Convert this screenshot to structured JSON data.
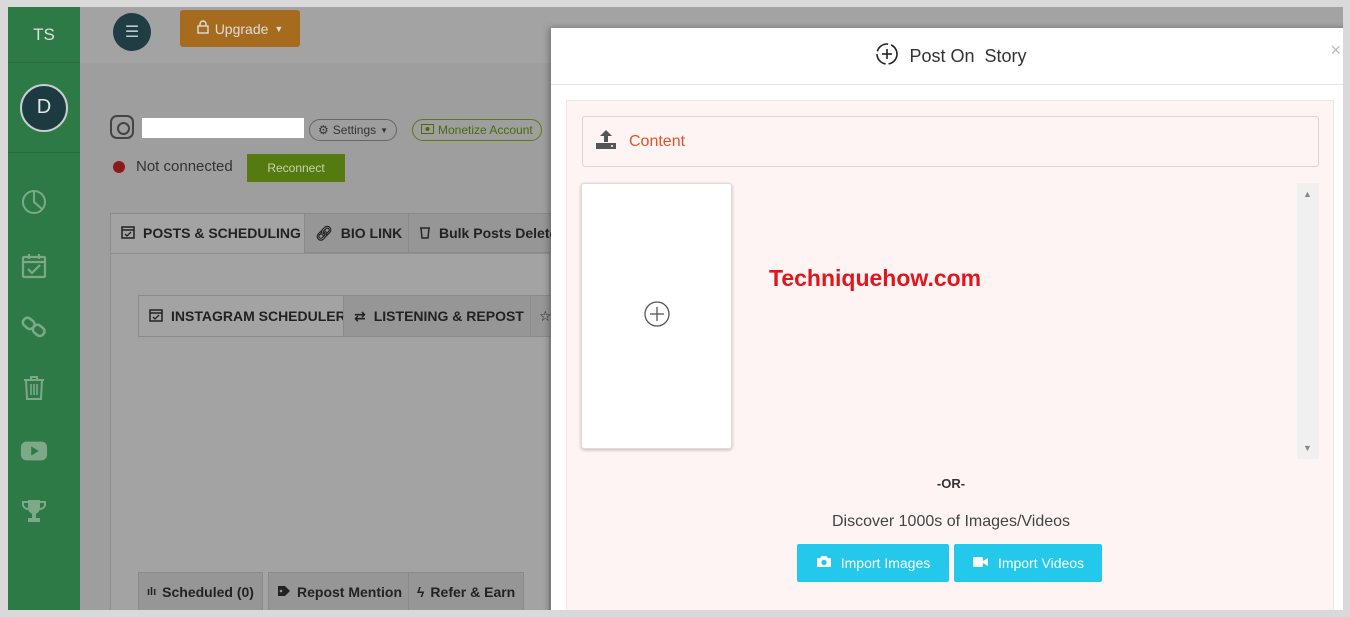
{
  "sidebar": {
    "logo": "TS",
    "avatar_initial": "D",
    "icons": [
      "pie-chart-icon",
      "calendar-check-icon",
      "link-icon",
      "trash-icon",
      "youtube-icon",
      "trophy-icon"
    ]
  },
  "topbar": {
    "upgrade_label": "Upgrade"
  },
  "account": {
    "settings_label": "Settings",
    "monetize_label": "Monetize Account",
    "status_text": "Not connected",
    "reconnect_label": "Reconnect"
  },
  "tabs": [
    {
      "label": "POSTS & SCHEDULING"
    },
    {
      "label": "BIO LINK"
    },
    {
      "label": "Bulk Posts Delete"
    }
  ],
  "subtabs": [
    {
      "label": "INSTAGRAM SCHEDULER"
    },
    {
      "label": "LISTENING & REPOST"
    }
  ],
  "bottom_tabs": [
    {
      "label": "Scheduled (0)"
    },
    {
      "label": "Repost Mention"
    },
    {
      "label": "Refer & Earn"
    }
  ],
  "modal": {
    "title_part1": "Post On",
    "title_part2": "Story",
    "close": "×",
    "content_label": "Content",
    "watermark": "Techniquehow.com",
    "or_text": "-OR-",
    "discover_text": "Discover 1000s of Images/Videos",
    "import_images_label": "Import Images",
    "import_videos_label": "Import Videos"
  },
  "colors": {
    "sidebar": "#2e7a47",
    "accent_orange": "#e1542a",
    "import_button": "#23c8eb",
    "watermark": "#e0161c"
  }
}
